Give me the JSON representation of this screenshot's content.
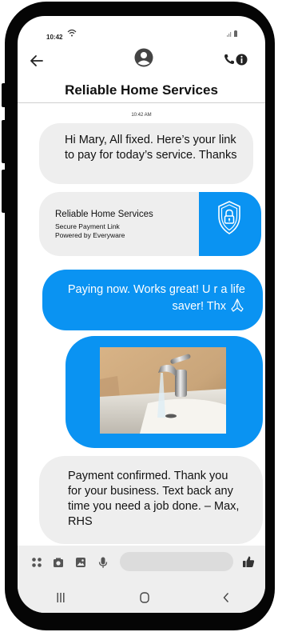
{
  "status": {
    "time": "10:42"
  },
  "header": {
    "contact_name": "Reliable Home Services",
    "back_icon": "arrow-left-icon",
    "call_icon": "phone-icon",
    "info_icon": "info-icon",
    "avatar_icon": "person-avatar-icon"
  },
  "thread": {
    "timestamp": "10:42 AM",
    "messages": [
      {
        "direction": "incoming",
        "text": "Hi Mary, All fixed. Here’s your link to pay for today’s service. Thanks"
      },
      {
        "direction": "incoming",
        "type": "link",
        "title": "Reliable Home Services",
        "line2": "Secure Payment Link",
        "line3": "Powered by Everyware",
        "icon": "shield-lock-icon"
      },
      {
        "direction": "outgoing",
        "text": "Paying now. Works great! U r a life saver! Thx",
        "emoji": "praying-hands-icon"
      },
      {
        "direction": "outgoing",
        "type": "image",
        "image": "faucet-photo"
      },
      {
        "direction": "incoming",
        "text": "Payment confirmed. Thank you for your business. Text back any time you need a job done. – Max, RHS"
      }
    ]
  },
  "compose": {
    "icons": [
      "apps-icon",
      "camera-icon",
      "gallery-icon",
      "microphone-icon"
    ],
    "send_icon": "thumbs-up-icon",
    "input_value": ""
  },
  "nav": {
    "icons": [
      "recents-icon",
      "home-icon",
      "back-icon"
    ]
  },
  "colors": {
    "accent": "#0a93f2",
    "bubble_in": "#eeeeee",
    "frame": "#050505"
  }
}
